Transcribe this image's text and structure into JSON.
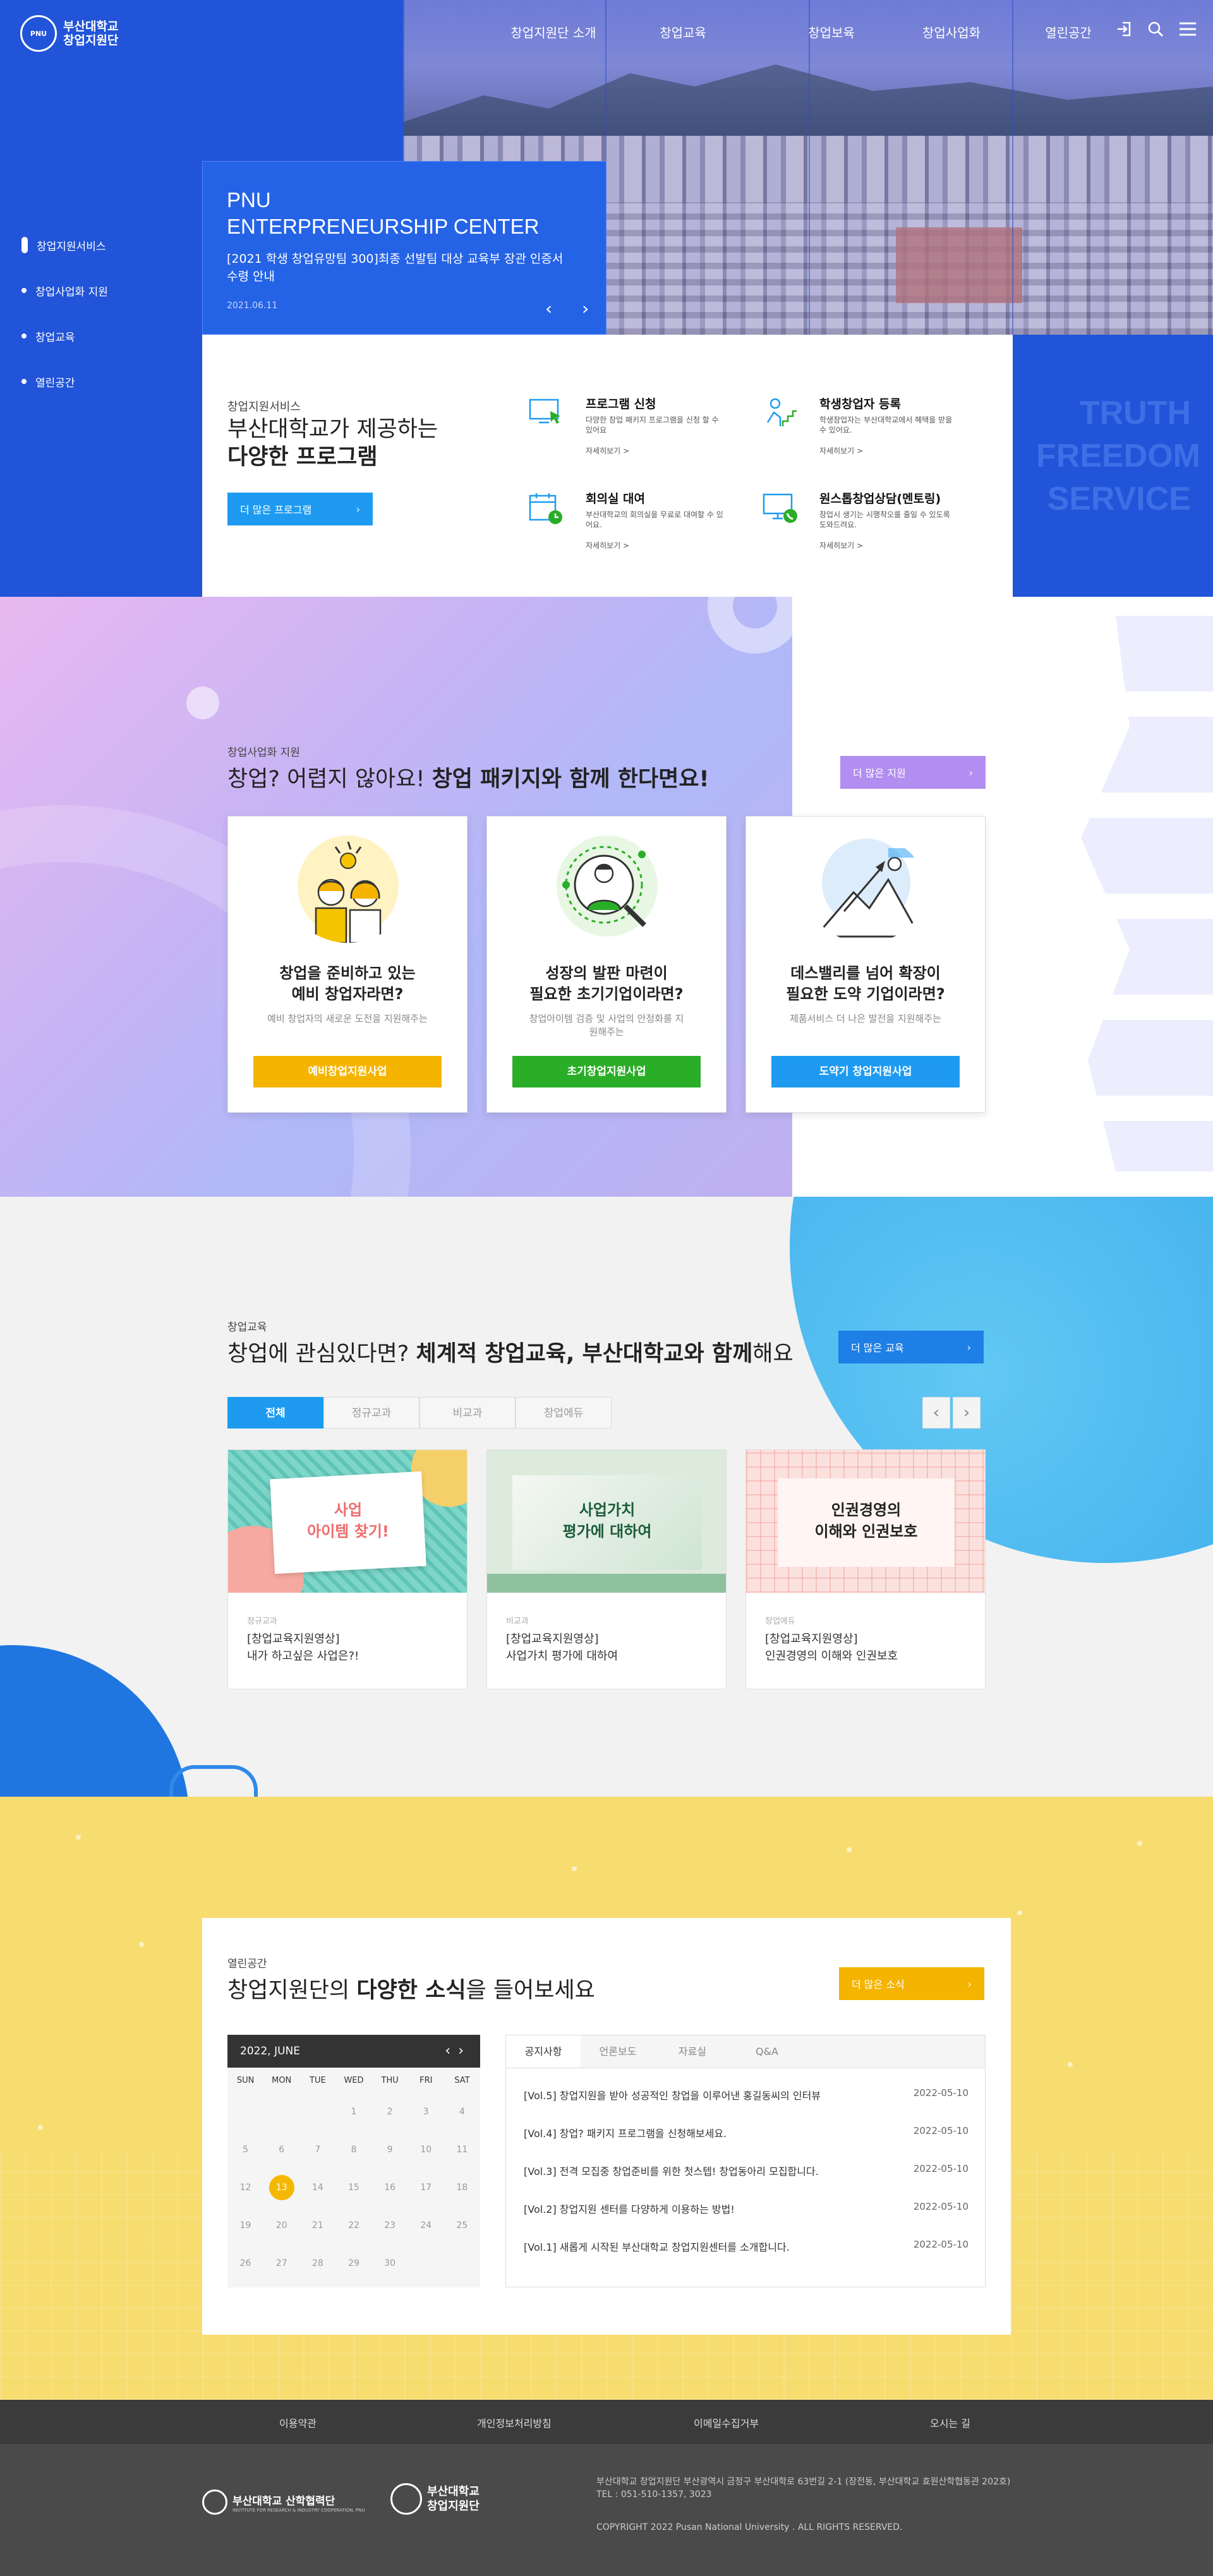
{
  "header": {
    "logo_line1": "부산대학교",
    "logo_line2": "창업지원단",
    "nav": [
      "창업지원단 소개",
      "창업교육",
      "창업보육",
      "창업사업화",
      "열린공간"
    ],
    "icons": [
      "login-icon",
      "search-icon",
      "menu-icon"
    ]
  },
  "sidenav": [
    "창업지원서비스",
    "창업사업화 지원",
    "창업교육",
    "열린공간"
  ],
  "hero": {
    "title_line1": "PNU",
    "title_line2": "ENTERPRENEURSHIP CENTER",
    "headline": "[2021 학생 창업유망팀 300]최종 선발팀 대상 교육부 장관 인증서 수령 안내",
    "date": "2021.06.11",
    "prev": "‹",
    "next": "›"
  },
  "services": {
    "sub": "창업지원서비스",
    "title_line1": "부산대학교가 제공하는",
    "title_line2": "다양한 프로그램",
    "more": "더 많은 프로그램",
    "items": [
      {
        "title": "프로그램 신청",
        "desc": "다양한 창업 패키지 프로그램을 신청 할 수 있어요",
        "link": "자세히보기 >",
        "icon": "computer-cursor-icon"
      },
      {
        "title": "학생창업자 등록",
        "desc": "학생창업자는 부산대학교에서 혜택을 받을 수 있어요.",
        "link": "자세히보기 >",
        "icon": "person-stairs-icon"
      },
      {
        "title": "회의실 대여",
        "desc": "부산대학교의 회의실을 무료로 대여할 수 있어요.",
        "link": "자세히보기 >",
        "icon": "calendar-clock-icon"
      },
      {
        "title": "원스톱창업상담(멘토링)",
        "desc": "창업시 생기는 시행착오를 줄일 수 있도록 도와드려요.",
        "link": "자세히보기 >",
        "icon": "monitor-phone-icon"
      }
    ],
    "slogan": [
      "TRUTH",
      "FREEDOM",
      "SERVICE"
    ]
  },
  "commercialization": {
    "sub": "창업사업화 지원",
    "title_normal": "창업? 어렵지 않아요! ",
    "title_bold": "창업 패키지와 함께 한다면요!",
    "more": "더 많은 지원",
    "cards": [
      {
        "title_line1": "창업을 준비하고 있는",
        "title_line2": "예비 창업자라면?",
        "desc": "예비 창업자의 새로운 도전을 지원해주는",
        "button": "예비창업지원사업",
        "color": "#f5b400"
      },
      {
        "title_line1": "성장의 발판 마련이",
        "title_line2": "필요한 초기기업이라면?",
        "desc": "창업아이템 검증 및 사업의 안정화를 지원해주는",
        "button": "초기창업지원사업",
        "color": "#2aad27"
      },
      {
        "title_line1": "데스밸리를 넘어 확장이",
        "title_line2": "필요한 도약 기업이라면?",
        "desc": "제품서비스 더 나은 발전을 지원해주는",
        "button": "도약기 창업지원사업",
        "color": "#1e9bf0"
      }
    ]
  },
  "education": {
    "sub": "창업교육",
    "title_normal1": "창업에 관심있다면? ",
    "title_bold": "체계적 창업교육, 부산대학교와 함께",
    "title_normal2": "해요",
    "more": "더 많은 교육",
    "tabs": [
      "전체",
      "정규교과",
      "비교과",
      "창업에듀"
    ],
    "cards": [
      {
        "thumb_line1": "사업",
        "thumb_line2": "아이템 찾기!",
        "category": "정규교과",
        "title_line1": "[창업교육지원영상]",
        "title_line2": "내가 하고싶은 사업은?!"
      },
      {
        "thumb_line1": "사업가치",
        "thumb_line2": "평가에 대하여",
        "category": "비교과",
        "title_line1": "[창업교육지원영상]",
        "title_line2": "사업가치 평가에 대하여"
      },
      {
        "thumb_line1": "인권경영의",
        "thumb_line2": "이해와 인권보호",
        "category": "창업에듀",
        "title_line1": "[창업교육지원영상]",
        "title_line2": "인권경영의 이해와 인권보호"
      }
    ]
  },
  "news": {
    "sub": "열린공간",
    "title_normal1": "창업지원단의 ",
    "title_bold": "다양한 소식",
    "title_normal2": "을 들어보세요",
    "more": "더 많은 소식",
    "calendar": {
      "month": "2022, JUNE",
      "weekdays": [
        "SUN",
        "MON",
        "TUE",
        "WED",
        "THU",
        "FRI",
        "SAT"
      ],
      "weeks": [
        [
          "",
          "",
          "",
          "1",
          "2",
          "3",
          "4"
        ],
        [
          "5",
          "6",
          "7",
          "8",
          "9",
          "10",
          "11"
        ],
        [
          "12",
          "13",
          "14",
          "15",
          "16",
          "17",
          "18"
        ],
        [
          "19",
          "20",
          "21",
          "22",
          "23",
          "24",
          "25"
        ],
        [
          "26",
          "27",
          "28",
          "29",
          "30",
          "",
          ""
        ]
      ],
      "today": "13"
    },
    "tabs": [
      "공지사항",
      "언론보도",
      "자료실",
      "Q&A"
    ],
    "items": [
      {
        "title": "[Vol.5] 창업지원을 받아 성공적인 창업을 이루어낸 홍길동씨의 인터뷰",
        "date": "2022-05-10"
      },
      {
        "title": "[Vol.4] 창업? 패키지 프로그램을 신청해보세요.",
        "date": "2022-05-10"
      },
      {
        "title": "[Vol.3] 전격 모집중 창업준비를 위한 첫스텝! 창업동아리 모집합니다.",
        "date": "2022-05-10"
      },
      {
        "title": "[Vol.2] 창업지원 센터를 다양하게 이용하는 방법!",
        "date": "2022-05-10"
      },
      {
        "title": "[Vol.1] 새롭게 시작된 부산대학교 창업지원센터를 소개합니다.",
        "date": "2022-05-10"
      }
    ]
  },
  "footer": {
    "links": [
      "이용약관",
      "개인정보처리방침",
      "이메일수집거부",
      "오시는 길"
    ],
    "logo1": "부산대학교 산학협력단",
    "logo1_sub": "INSTITUTE FOR RESEARCH & INDUSTRY COOPERATION, PNU",
    "logo2_line1": "부산대학교",
    "logo2_line2": "창업지원단",
    "address": "부산대학교 창업지원단    부산광역시 금정구 부산대학로 63번길 2-1 (장전동, 부산대학교 효원산학협동관 202호)",
    "tel": "TEL : 051-510-1357, 3023",
    "copyright": "COPYRIGHT 2022 Pusan National University . ALL RIGHTS RESERVED."
  }
}
